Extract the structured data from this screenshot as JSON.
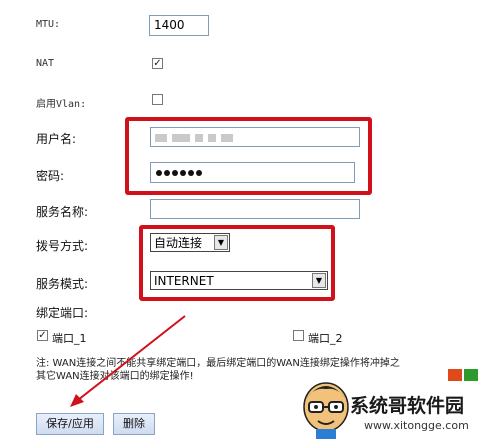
{
  "form": {
    "mtu": {
      "label": "MTU:",
      "value": "1400"
    },
    "nat": {
      "label": "NAT",
      "checked": true,
      "check_glyph": "✓"
    },
    "vlan": {
      "label": "启用Vlan:",
      "checked": false
    },
    "username": {
      "label": "用户名:"
    },
    "password": {
      "label": "密码:"
    },
    "service_name": {
      "label": "服务名称:",
      "value": ""
    },
    "dial_mode": {
      "label": "拨号方式:",
      "selected": "自动连接"
    },
    "service_mode": {
      "label": "服务模式:",
      "selected": "INTERNET"
    },
    "bind_port": {
      "label": "绑定端口:",
      "ports": [
        {
          "label": "端口_1",
          "checked": true
        },
        {
          "label": "端口_2",
          "checked": false
        }
      ]
    },
    "note": {
      "line1": "注: WAN连接之间不能共享绑定端口，最后绑定端口的WAN连接绑定操作将冲掉之",
      "line2": "其它WAN连接对该端口的绑定操作!"
    }
  },
  "buttons": {
    "save": "保存/应用",
    "delete": "删除"
  },
  "watermark": {
    "brand": "系统哥软件园",
    "url": "www.xitongge.com"
  },
  "colors": {
    "highlight": "#d0101b",
    "field_border": "#7f9db9"
  }
}
